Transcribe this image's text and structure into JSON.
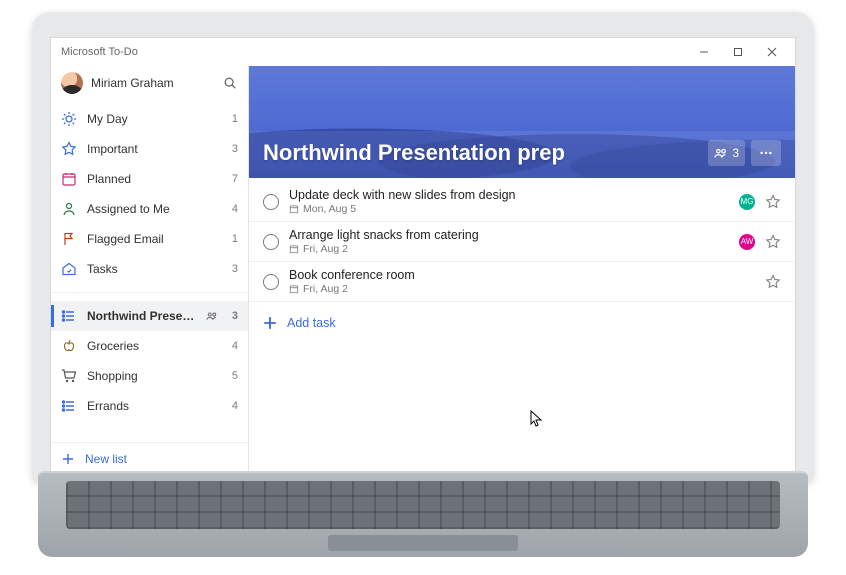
{
  "window": {
    "title": "Microsoft To-Do"
  },
  "user": {
    "name": "Miriam Graham"
  },
  "sidebar": {
    "smart": [
      {
        "icon": "sun",
        "label": "My Day",
        "count": "1"
      },
      {
        "icon": "star",
        "label": "Important",
        "count": "3"
      },
      {
        "icon": "calendar",
        "label": "Planned",
        "count": "7"
      },
      {
        "icon": "person",
        "label": "Assigned to Me",
        "count": "4"
      },
      {
        "icon": "flag",
        "label": "Flagged Email",
        "count": "1"
      },
      {
        "icon": "home",
        "label": "Tasks",
        "count": "3"
      }
    ],
    "lists": [
      {
        "icon": "list",
        "label": "Northwind Presentation…",
        "count": "3",
        "shared_count": "3",
        "selected": true
      },
      {
        "icon": "produce",
        "label": "Groceries",
        "count": "4"
      },
      {
        "icon": "cart",
        "label": "Shopping",
        "count": "5"
      },
      {
        "icon": "list",
        "label": "Errands",
        "count": "4"
      }
    ],
    "new_list_label": "New list"
  },
  "main": {
    "list_title": "Northwind Presentation prep",
    "share_count": "3",
    "tasks": [
      {
        "title": "Update deck with new slides from design",
        "due": "Mon, Aug 5",
        "assignee_initials": "MG",
        "assignee_color": "#00b294"
      },
      {
        "title": "Arrange light snacks from catering",
        "due": "Fri, Aug 2",
        "assignee_initials": "AW",
        "assignee_color": "#e3008c"
      },
      {
        "title": "Book conference room",
        "due": "Fri, Aug 2"
      }
    ],
    "add_task_label": "Add task"
  }
}
